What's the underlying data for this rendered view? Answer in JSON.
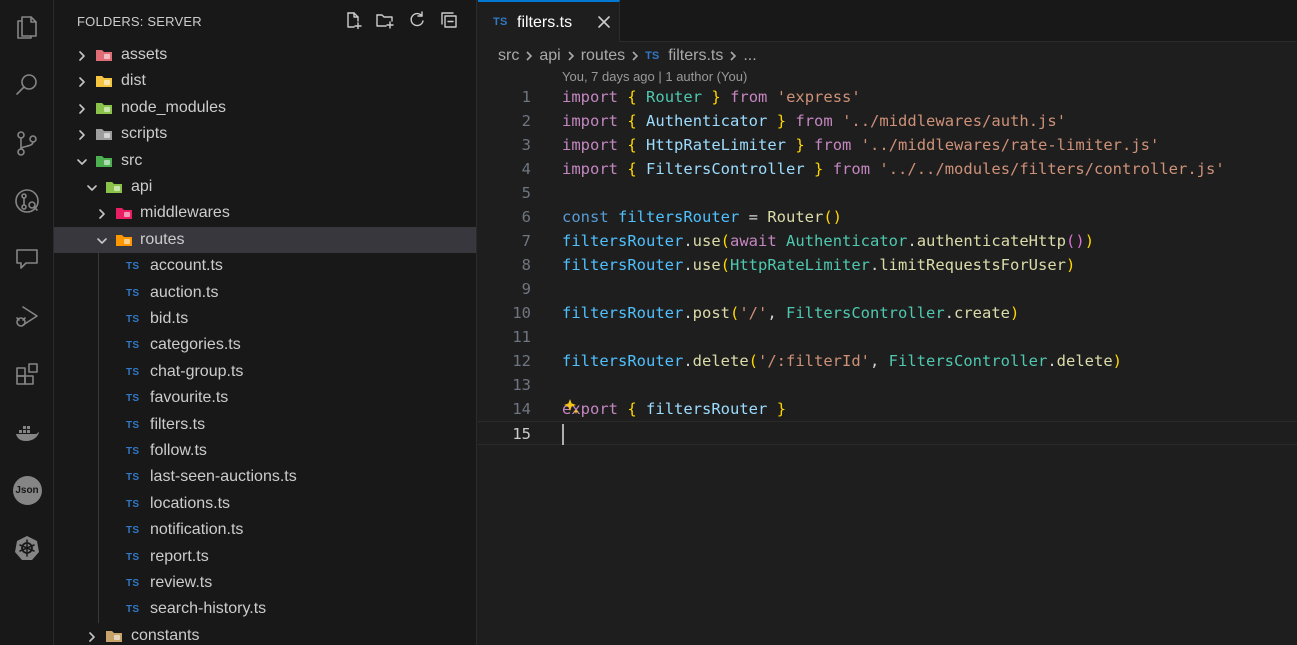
{
  "activity_bar": {
    "icons": [
      "explorer-icon",
      "search-icon",
      "source-control-icon",
      "git-graph-icon",
      "chat-icon",
      "run-debug-icon",
      "extensions-icon",
      "docker-icon",
      "json-icon",
      "kubernetes-icon"
    ],
    "json_label": "Json"
  },
  "sidebar": {
    "title": "FOLDERS: SERVER",
    "actions": [
      "new-file-icon",
      "new-folder-icon",
      "refresh-icon",
      "collapse-all-icon"
    ],
    "tree": [
      {
        "label": "assets",
        "type": "folder",
        "expanded": false,
        "depth": 0,
        "color": "#e06c75"
      },
      {
        "label": "dist",
        "type": "folder",
        "expanded": false,
        "depth": 0,
        "color": "#f5c542"
      },
      {
        "label": "node_modules",
        "type": "folder",
        "expanded": false,
        "depth": 0,
        "color": "#8bc34a"
      },
      {
        "label": "scripts",
        "type": "folder",
        "expanded": false,
        "depth": 0,
        "color": "#9e9e9e"
      },
      {
        "label": "src",
        "type": "folder",
        "expanded": true,
        "depth": 0,
        "color": "#4caf50"
      },
      {
        "label": "api",
        "type": "folder",
        "expanded": true,
        "depth": 1,
        "color": "#8bc34a"
      },
      {
        "label": "middlewares",
        "type": "folder",
        "expanded": false,
        "depth": 2,
        "color": "#e91e63"
      },
      {
        "label": "routes",
        "type": "folder",
        "expanded": true,
        "depth": 2,
        "color": "#ff9800",
        "selected": true
      },
      {
        "label": "account.ts",
        "type": "ts",
        "depth": 3
      },
      {
        "label": "auction.ts",
        "type": "ts",
        "depth": 3
      },
      {
        "label": "bid.ts",
        "type": "ts",
        "depth": 3
      },
      {
        "label": "categories.ts",
        "type": "ts",
        "depth": 3
      },
      {
        "label": "chat-group.ts",
        "type": "ts",
        "depth": 3
      },
      {
        "label": "favourite.ts",
        "type": "ts",
        "depth": 3
      },
      {
        "label": "filters.ts",
        "type": "ts",
        "depth": 3
      },
      {
        "label": "follow.ts",
        "type": "ts",
        "depth": 3
      },
      {
        "label": "last-seen-auctions.ts",
        "type": "ts",
        "depth": 3
      },
      {
        "label": "locations.ts",
        "type": "ts",
        "depth": 3
      },
      {
        "label": "notification.ts",
        "type": "ts",
        "depth": 3
      },
      {
        "label": "report.ts",
        "type": "ts",
        "depth": 3
      },
      {
        "label": "review.ts",
        "type": "ts",
        "depth": 3
      },
      {
        "label": "search-history.ts",
        "type": "ts",
        "depth": 3
      },
      {
        "label": "constants",
        "type": "folder",
        "expanded": false,
        "depth": 1,
        "color": "#c8a46b"
      }
    ],
    "ts_badge": "TS"
  },
  "editor": {
    "tab": {
      "badge": "TS",
      "label": "filters.ts"
    },
    "breadcrumb": {
      "parts": [
        "src",
        "api",
        "routes"
      ],
      "file_badge": "TS",
      "file": "filters.ts",
      "more": "..."
    },
    "codelens": "You, 7 days ago | 1 author (You)",
    "active_line": 15,
    "lines": [
      [
        [
          "kw",
          "import"
        ],
        [
          "op",
          " "
        ],
        [
          "br1",
          "{"
        ],
        [
          "op",
          " "
        ],
        [
          "cls",
          "Router"
        ],
        [
          "op",
          " "
        ],
        [
          "br1",
          "}"
        ],
        [
          "op",
          " "
        ],
        [
          "kw",
          "from"
        ],
        [
          "op",
          " "
        ],
        [
          "str",
          "'express'"
        ]
      ],
      [
        [
          "kw",
          "import"
        ],
        [
          "op",
          " "
        ],
        [
          "br1",
          "{"
        ],
        [
          "op",
          " "
        ],
        [
          "id",
          "Authenticator"
        ],
        [
          "op",
          " "
        ],
        [
          "br1",
          "}"
        ],
        [
          "op",
          " "
        ],
        [
          "kw",
          "from"
        ],
        [
          "op",
          " "
        ],
        [
          "str",
          "'../middlewares/auth.js'"
        ]
      ],
      [
        [
          "kw",
          "import"
        ],
        [
          "op",
          " "
        ],
        [
          "br1",
          "{"
        ],
        [
          "op",
          " "
        ],
        [
          "id",
          "HttpRateLimiter"
        ],
        [
          "op",
          " "
        ],
        [
          "br1",
          "}"
        ],
        [
          "op",
          " "
        ],
        [
          "kw",
          "from"
        ],
        [
          "op",
          " "
        ],
        [
          "str",
          "'../middlewares/rate-limiter.js'"
        ]
      ],
      [
        [
          "kw",
          "import"
        ],
        [
          "op",
          " "
        ],
        [
          "br1",
          "{"
        ],
        [
          "op",
          " "
        ],
        [
          "id",
          "FiltersController"
        ],
        [
          "op",
          " "
        ],
        [
          "br1",
          "}"
        ],
        [
          "op",
          " "
        ],
        [
          "kw",
          "from"
        ],
        [
          "op",
          " "
        ],
        [
          "str",
          "'../../modules/filters/controller.js'"
        ]
      ],
      [],
      [
        [
          "kw2",
          "const"
        ],
        [
          "op",
          " "
        ],
        [
          "var",
          "filtersRouter"
        ],
        [
          "op",
          " = "
        ],
        [
          "fn",
          "Router"
        ],
        [
          "br1",
          "()"
        ]
      ],
      [
        [
          "var",
          "filtersRouter"
        ],
        [
          "op",
          "."
        ],
        [
          "fn",
          "use"
        ],
        [
          "br1",
          "("
        ],
        [
          "kw",
          "await"
        ],
        [
          "op",
          " "
        ],
        [
          "cls",
          "Authenticator"
        ],
        [
          "op",
          "."
        ],
        [
          "fn",
          "authenticateHttp"
        ],
        [
          "br2",
          "()"
        ],
        [
          "br1",
          ")"
        ]
      ],
      [
        [
          "var",
          "filtersRouter"
        ],
        [
          "op",
          "."
        ],
        [
          "fn",
          "use"
        ],
        [
          "br1",
          "("
        ],
        [
          "cls",
          "HttpRateLimiter"
        ],
        [
          "op",
          "."
        ],
        [
          "fn",
          "limitRequestsForUser"
        ],
        [
          "br1",
          ")"
        ]
      ],
      [],
      [
        [
          "var",
          "filtersRouter"
        ],
        [
          "op",
          "."
        ],
        [
          "fn",
          "post"
        ],
        [
          "br1",
          "("
        ],
        [
          "str",
          "'/'"
        ],
        [
          "op",
          ", "
        ],
        [
          "cls",
          "FiltersController"
        ],
        [
          "op",
          "."
        ],
        [
          "fn",
          "create"
        ],
        [
          "br1",
          ")"
        ]
      ],
      [],
      [
        [
          "var",
          "filtersRouter"
        ],
        [
          "op",
          "."
        ],
        [
          "fn",
          "delete"
        ],
        [
          "br1",
          "("
        ],
        [
          "str",
          "'/:filterId'"
        ],
        [
          "op",
          ", "
        ],
        [
          "cls",
          "FiltersController"
        ],
        [
          "op",
          "."
        ],
        [
          "fn",
          "delete"
        ],
        [
          "br1",
          ")"
        ]
      ],
      [],
      [
        [
          "kw",
          "export"
        ],
        [
          "op",
          " "
        ],
        [
          "br1",
          "{"
        ],
        [
          "op",
          " "
        ],
        [
          "id",
          "filtersRouter"
        ],
        [
          "op",
          " "
        ],
        [
          "br1",
          "}"
        ]
      ],
      []
    ]
  }
}
